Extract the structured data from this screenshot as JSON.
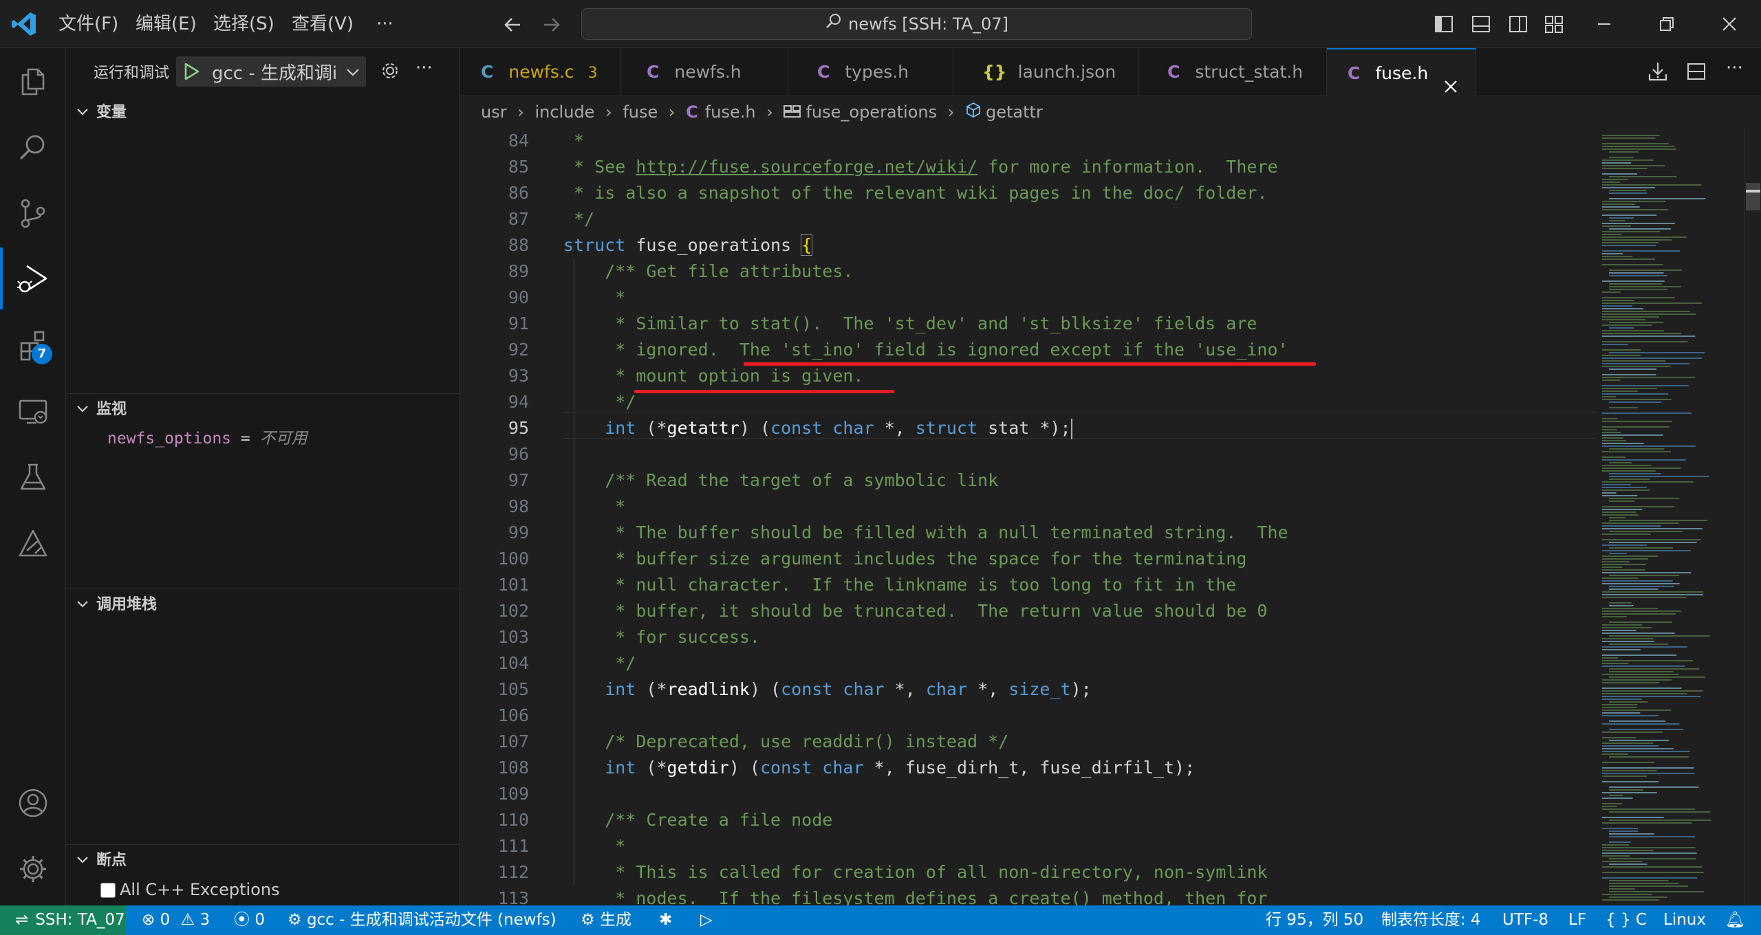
{
  "menu": {
    "file": "文件(F)",
    "edit": "编辑(E)",
    "select": "选择(S)",
    "view": "查看(V)",
    "more": "···"
  },
  "search": {
    "text": "newfs [SSH: TA_07]"
  },
  "activity": {
    "extensions_badge": "7"
  },
  "sidebar": {
    "run_debug_label": "运行和调试",
    "config_name": "gcc - 生成和调i",
    "variables_header": "变量",
    "watch_header": "监视",
    "watch_items": [
      {
        "name": "newfs_options",
        "eq": " = ",
        "value": "不可用"
      }
    ],
    "callstack_header": "调用堆栈",
    "breakpoints_header": "断点",
    "breakpoint_item": "All C++ Exceptions"
  },
  "tabs": [
    {
      "label": "newfs.c",
      "badge": "3"
    },
    {
      "label": "newfs.h"
    },
    {
      "label": "types.h"
    },
    {
      "label": "launch.json"
    },
    {
      "label": "struct_stat.h"
    },
    {
      "label": "fuse.h"
    }
  ],
  "breadcrumb": {
    "p1": "usr",
    "p2": "include",
    "p3": "fuse",
    "p4": "fuse.h",
    "p5": "fuse_operations",
    "p6": "getattr"
  },
  "code": {
    "lines": [
      "84",
      "85",
      "86",
      "87",
      "88",
      "89",
      "90",
      "91",
      "92",
      "93",
      "94",
      "95",
      "96",
      "97",
      "98",
      "99",
      "100",
      "101",
      "102",
      "103",
      "104",
      "105",
      "106",
      "107",
      "108",
      "109",
      "110",
      "111",
      "112",
      "113"
    ],
    "l84": " *",
    "l85a": " * See ",
    "l85link": "http://fuse.sourceforge.net/wiki/",
    "l85b": " for more information.  There",
    "l86": " * is also a snapshot of the relevant wiki pages in the doc/ folder.",
    "l87": " */",
    "l88a": "struct",
    "l88b": " fuse_operations ",
    "l88c": "{",
    "l89": "    /** Get file attributes.",
    "l90": "     *",
    "l91": "     * Similar to stat().  The 'st_dev' and 'st_blksize' fields are",
    "l92": "     * ignored.  The 'st_ino' field is ignored except if the 'use_ino'",
    "l93": "     * mount option is given.",
    "l94": "     */",
    "l95a": "    int",
    "l95b": " (*",
    "l95c": "getattr",
    "l95d": ") (",
    "l95e": "const char",
    "l95f": " *, ",
    "l95g": "struct",
    "l95h": " stat *);",
    "l96": "",
    "l97": "    /** Read the target of a symbolic link",
    "l98": "     *",
    "l99": "     * The buffer should be filled with a null terminated string.  The",
    "l100": "     * buffer size argument includes the space for the terminating",
    "l101": "     * null character.  If the linkname is too long to fit in the",
    "l102": "     * buffer, it should be truncated.  The return value should be 0",
    "l103": "     * for success.",
    "l104": "     */",
    "l105a": "    int",
    "l105b": " (*",
    "l105c": "readlink",
    "l105d": ") (",
    "l105e": "const char",
    "l105f": " *, ",
    "l105g": "char",
    "l105h": " *, ",
    "l105i": "size_t",
    "l105j": ");",
    "l106": "",
    "l107": "    /* Deprecated, use readdir() instead */",
    "l108a": "    int",
    "l108b": " (*",
    "l108c": "getdir",
    "l108d": ") (",
    "l108e": "const char",
    "l108f": " *, fuse_dirh_t, fuse_dirfil_t);",
    "l109": "",
    "l110": "    /** Create a file node",
    "l111": "     *",
    "l112": "     * This is called for creation of all non-directory, non-symlink",
    "l113": "     * nodes.  If the filesystem defines a create() method, then for"
  },
  "status": {
    "remote": "SSH: TA_07",
    "errors": "0",
    "warnings": "3",
    "ports": "0",
    "debug_config": "gcc - 生成和调试活动文件 (newfs)",
    "build": "生成",
    "position": "行 95，列 50",
    "tabsize": "制表符长度: 4",
    "encoding": "UTF-8",
    "eol": "LF",
    "lang": "C",
    "platform": "Linux"
  },
  "colors": {
    "accent": "#0078d4",
    "status_bg": "#007acc",
    "annotation": "#e51b23",
    "comment": "#6a9955",
    "keyword": "#569cd6"
  }
}
